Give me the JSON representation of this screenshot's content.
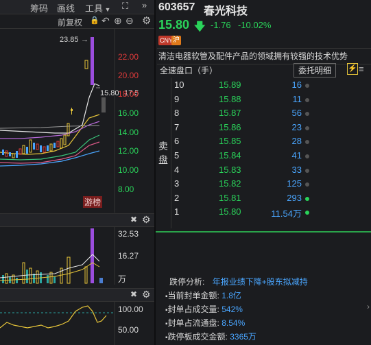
{
  "toolbar": {
    "chips": "筹码",
    "draw": "画线",
    "tools": "工具",
    "qfq": "前复权"
  },
  "chart": {
    "high_label": "23.85",
    "current_label": "15.80",
    "current_label2": "17.5",
    "price_axis": [
      "22.00",
      "20.00",
      "18.00",
      "16.00",
      "14.00",
      "12.00",
      "10.00",
      "8.00"
    ],
    "tag": "游榜",
    "volume_axis": [
      "32.53",
      "16.27",
      "万"
    ],
    "ind_axis": [
      "100.00",
      "50.00"
    ]
  },
  "stock": {
    "code": "603657",
    "name": "春光科技",
    "price": "15.80",
    "change": "-1.76",
    "change_pct": "-10.02%",
    "badges": [
      "CNY",
      "沪"
    ],
    "description": "清洁电器软管及配件产品的领域拥有较强的技术优势"
  },
  "orderbook": {
    "title": "全速盘口（手）",
    "order_detail_button": "委托明细",
    "side_label": "卖盘",
    "rows": [
      {
        "level": "10",
        "price": "15.89",
        "volume": "16"
      },
      {
        "level": "9",
        "price": "15.88",
        "volume": "11"
      },
      {
        "level": "8",
        "price": "15.87",
        "volume": "56"
      },
      {
        "level": "7",
        "price": "15.86",
        "volume": "23"
      },
      {
        "level": "6",
        "price": "15.85",
        "volume": "28"
      },
      {
        "level": "5",
        "price": "15.84",
        "volume": "41"
      },
      {
        "level": "4",
        "price": "15.83",
        "volume": "33"
      },
      {
        "level": "3",
        "price": "15.82",
        "volume": "125"
      },
      {
        "level": "2",
        "price": "15.81",
        "volume": "293"
      },
      {
        "level": "1",
        "price": "15.80",
        "volume": "11.54万"
      }
    ]
  },
  "limit_info": {
    "analysis_label": "跌停分析:",
    "analysis_value": "年报业绩下降+股东拟减持",
    "items": [
      {
        "label": "当前封单金额:",
        "value": "1.8亿"
      },
      {
        "label": "封单占成交量:",
        "value": "542%"
      },
      {
        "label": "封单占流通盘:",
        "value": "8.54%"
      },
      {
        "label": "跌停板成交金额:",
        "value": "3365万"
      }
    ]
  },
  "colors": {
    "up": "#e03a3a",
    "down": "#2ad35a",
    "volume_blue": "#4aa6ff",
    "highlight_purple": "#9b4dde"
  }
}
